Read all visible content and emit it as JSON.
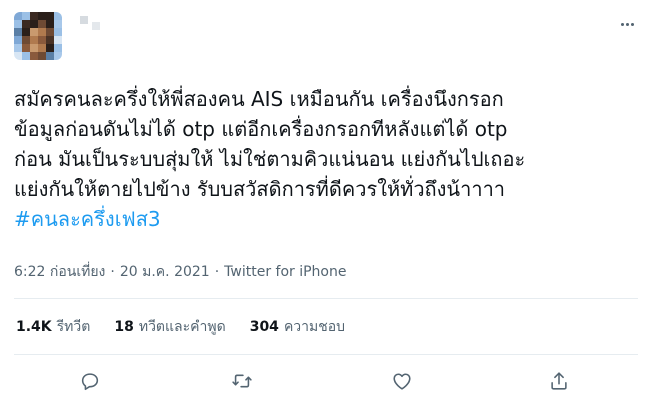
{
  "tweet": {
    "lines": [
      "สมัครคนละครึ่งให้พี่สองคน AIS เหมือนกัน เครื่องนึงกรอก",
      "ข้อมูลก่อนดันไม่ได้ otp แต่อีกเครื่องกรอกทีหลังแต่ได้ otp",
      "ก่อน มันเป็นระบบสุ่มให้ ไม่ใช่ตามคิวแน่นอน แย่งกันไปเถอะ",
      "แย่งกันให้ตายไปข้าง รับบสวัสดิการที่ดีควรให้ทั่วถึงน้าาาา"
    ],
    "hashtag": "#คนละครึ่งเฟส3",
    "time": "6:22 ก่อนเที่ยง",
    "separator": "·",
    "date": "20 ม.ค. 2021",
    "source": "Twitter for iPhone"
  },
  "stats": {
    "retweets": {
      "count": "1.4K",
      "label": "รีทวีต"
    },
    "quotes": {
      "count": "18",
      "label": "ทวีตและคำพูด"
    },
    "likes": {
      "count": "304",
      "label": "ความชอบ"
    }
  },
  "actions": [
    "reply-icon",
    "retweet-icon",
    "like-icon",
    "share-icon"
  ],
  "colors": {
    "text": "#0f1419",
    "muted": "#536471",
    "link": "#1d9bf0",
    "divider": "#e6ecf0"
  }
}
